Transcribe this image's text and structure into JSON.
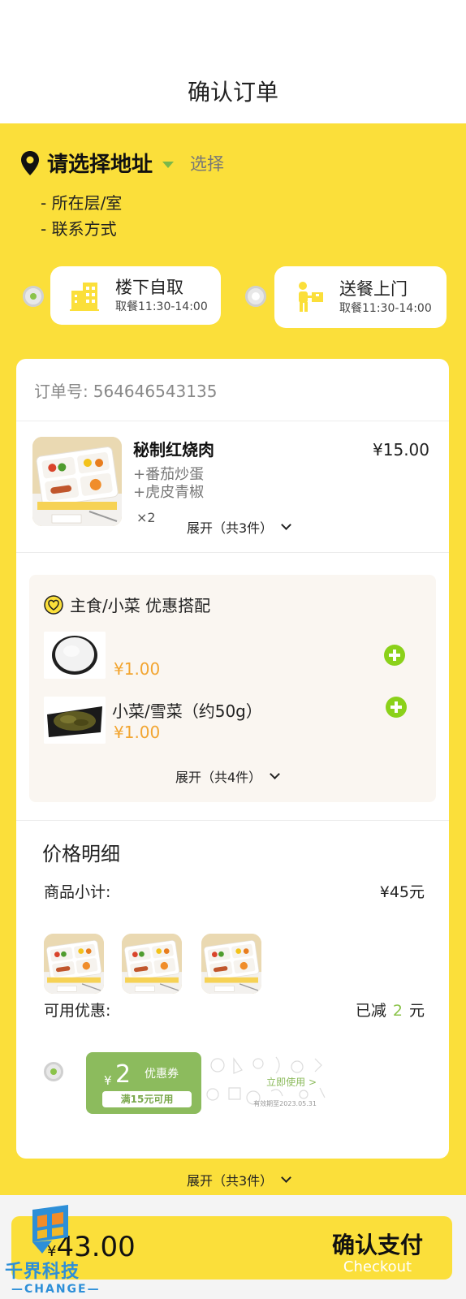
{
  "header": {
    "title": "确认订单"
  },
  "address": {
    "title": "请选择地址",
    "select_label": "选择",
    "lines": [
      "- 所在层/室",
      "-  联系方式"
    ]
  },
  "delivery_options": [
    {
      "label": "楼下自取",
      "time": "取餐11:30-14:00",
      "selected": true
    },
    {
      "label": "送餐上门",
      "time": "取餐11:30-14:00",
      "selected": false
    }
  ],
  "order": {
    "number_label": "订单号:",
    "number": "564646543135",
    "dish": {
      "name": "秘制红烧肉",
      "sides": [
        "+番茄炒蛋",
        "+虎皮青椒"
      ],
      "qty": "×2",
      "price": "¥15.00"
    },
    "expand_label": "展开（共3件）"
  },
  "combo": {
    "title": "主食/小菜 优惠搭配",
    "items": [
      {
        "name": "",
        "price": "¥1.00"
      },
      {
        "name": "小菜/雪菜（约50g）",
        "price": "¥1.00"
      }
    ],
    "expand_label": "展开（共4件）"
  },
  "price_detail": {
    "title": "价格明细",
    "subtotal_label": "商品小计:",
    "subtotal_value": "¥45元",
    "discount_label": "可用优惠:",
    "discount_prefix": "已减",
    "discount_amount": "2",
    "discount_suffix": "元"
  },
  "coupon": {
    "yen": "¥",
    "amount": "2",
    "type": "优惠券",
    "condition": "满15元可用",
    "use_label": "立即使用 >",
    "expiry": "有效期至2023.05.31"
  },
  "bottom_expand_label": "展开（共3件）",
  "footer": {
    "yen": "¥",
    "total": "43.00",
    "pay_label": "确认支付",
    "pay_sub": "Checkout"
  },
  "watermark": {
    "name": "千界科技",
    "sub": "CHANGE"
  },
  "colors": {
    "accent": "#fbdf3a",
    "green": "#8bc34a",
    "orange": "#f2a531"
  }
}
